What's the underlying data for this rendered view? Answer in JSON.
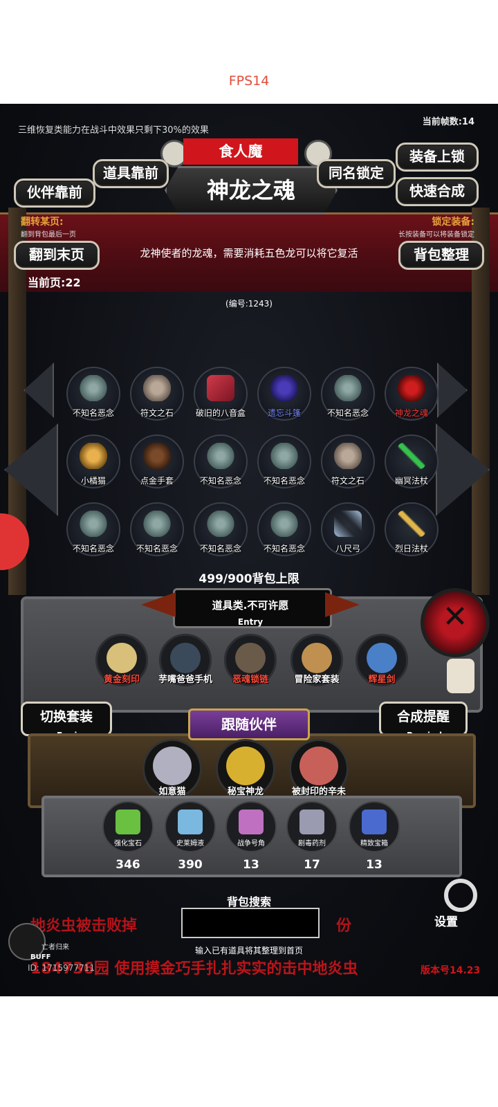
{
  "hud": {
    "fps": "FPS14",
    "system_message": "三维恢复类能力在战斗中效果只剩下30%的效果",
    "frame_count": "当前帧数:14"
  },
  "header": {
    "enemy_name": "食人魔",
    "item_title": "神龙之魂",
    "btn_prop_front": "道具靠前",
    "btn_partner_front": "伙伴靠前",
    "btn_same_name_lock": "同名锁定",
    "btn_equip_lock": "装备上锁",
    "btn_quick_combine": "快速合成",
    "flip_page_label": "翻转某页:",
    "flip_page_hint": "翻到背包最后一页",
    "lock_equip_label": "锁定装备:",
    "lock_equip_hint": "长按装备可以将装备锁定",
    "btn_last_page": "翻到末页",
    "btn_sort_bag": "背包整理",
    "item_description": "龙神使者的龙魂，需要消耗五色龙可以将它复活",
    "current_page": "当前页:22",
    "item_number": "(编号:1243)"
  },
  "inventory": [
    {
      "label": "不知名恶念",
      "icon": "ghost-icon",
      "kind": "ghost"
    },
    {
      "label": "符文之石",
      "icon": "rune-stone-icon",
      "kind": "rock"
    },
    {
      "label": "破旧的八音盒",
      "icon": "music-box-icon",
      "kind": "box"
    },
    {
      "label": "遗忘斗篷",
      "icon": "cloak-icon",
      "kind": "cloak",
      "color": "#7b8cff"
    },
    {
      "label": "不知名恶念",
      "icon": "ghost-icon",
      "kind": "ghost"
    },
    {
      "label": "神龙之魂",
      "icon": "dragon-soul-icon",
      "kind": "dragon",
      "color": "#ff3a3a"
    },
    {
      "label": "小橘猫",
      "icon": "cat-icon",
      "kind": "cat"
    },
    {
      "label": "点金手套",
      "icon": "glove-icon",
      "kind": "glove"
    },
    {
      "label": "不知名恶念",
      "icon": "ghost-icon",
      "kind": "ghost"
    },
    {
      "label": "不知名恶念",
      "icon": "ghost-icon",
      "kind": "ghost"
    },
    {
      "label": "符文之石",
      "icon": "rune-stone-icon",
      "kind": "rock"
    },
    {
      "label": "幽冥法杖",
      "icon": "staff-icon",
      "kind": "staffg"
    },
    {
      "label": "不知名恶念",
      "icon": "ghost-icon",
      "kind": "ghost"
    },
    {
      "label": "不知名恶念",
      "icon": "ghost-icon",
      "kind": "ghost"
    },
    {
      "label": "不知名恶念",
      "icon": "ghost-icon",
      "kind": "ghost"
    },
    {
      "label": "不知名恶念",
      "icon": "ghost-icon",
      "kind": "ghost"
    },
    {
      "label": "八尺弓",
      "icon": "bow-icon",
      "kind": "bow"
    },
    {
      "label": "烈日法杖",
      "icon": "staff-icon",
      "kind": "stafy"
    }
  ],
  "bag_capacity": "499/900背包上限",
  "category": {
    "title": "道具类.不可许愿",
    "sub": "Entry"
  },
  "equipment": [
    {
      "label": "黄金刻印",
      "icon": "seal-icon",
      "color": "#ff4a3a",
      "pic": "#d8c07a"
    },
    {
      "label": "芋嘴爸爸手机",
      "icon": "phone-icon",
      "color": "#ffffff",
      "pic": "#3a4a5a"
    },
    {
      "label": "恶魂锁链",
      "icon": "chain-icon",
      "color": "#ff4a3a",
      "pic": "#6a5a4a"
    },
    {
      "label": "冒险家套装",
      "icon": "adventurer-icon",
      "color": "#ffffff",
      "pic": "#c09050"
    },
    {
      "label": "辉星剑",
      "icon": "sword-icon",
      "color": "#ff4a3a",
      "pic": "#4a80c8"
    }
  ],
  "side": {
    "switch_set": "切换套装",
    "switch_set_sub": "Equip",
    "combine_remind": "合成提醒",
    "combine_remind_sub": "Remind"
  },
  "companions": {
    "title": "跟随伙伴",
    "items": [
      {
        "label": "如意猫",
        "icon": "nyan-cat-icon",
        "pic": "#b0b0c0"
      },
      {
        "label": "秘宝神龙",
        "icon": "gold-dragon-icon",
        "pic": "#d8b030"
      },
      {
        "label": "被封印的辛未",
        "icon": "demon-icon",
        "pic": "#c8605a"
      }
    ]
  },
  "resources": [
    {
      "label": "强化宝石",
      "count": "346",
      "icon": "gem-icon",
      "pic": "#6ac040"
    },
    {
      "label": "史莱姆液",
      "count": "390",
      "icon": "potion-icon",
      "pic": "#7ab8e0"
    },
    {
      "label": "战争号角",
      "count": "13",
      "icon": "horn-icon",
      "pic": "#c070c0"
    },
    {
      "label": "剧毒药剂",
      "count": "17",
      "icon": "poison-icon",
      "pic": "#9a9ab0"
    },
    {
      "label": "精致宝箱",
      "count": "13",
      "icon": "chest-icon",
      "pic": "#4a6ad0"
    }
  ],
  "search": {
    "label": "背包搜索",
    "hint": "输入已有道具将其整理到首页",
    "value": ""
  },
  "log": {
    "line1a": "地炎虫被击败掉",
    "line1b": "份",
    "line2": "184736园 使用摸金巧手扎扎实实的击中地炎虫",
    "uid": "ID: 1715977711"
  },
  "footer": {
    "buff": "BUFF",
    "buff_sub": "亡者归来",
    "settings": "设置",
    "version": "版本号14.23"
  }
}
